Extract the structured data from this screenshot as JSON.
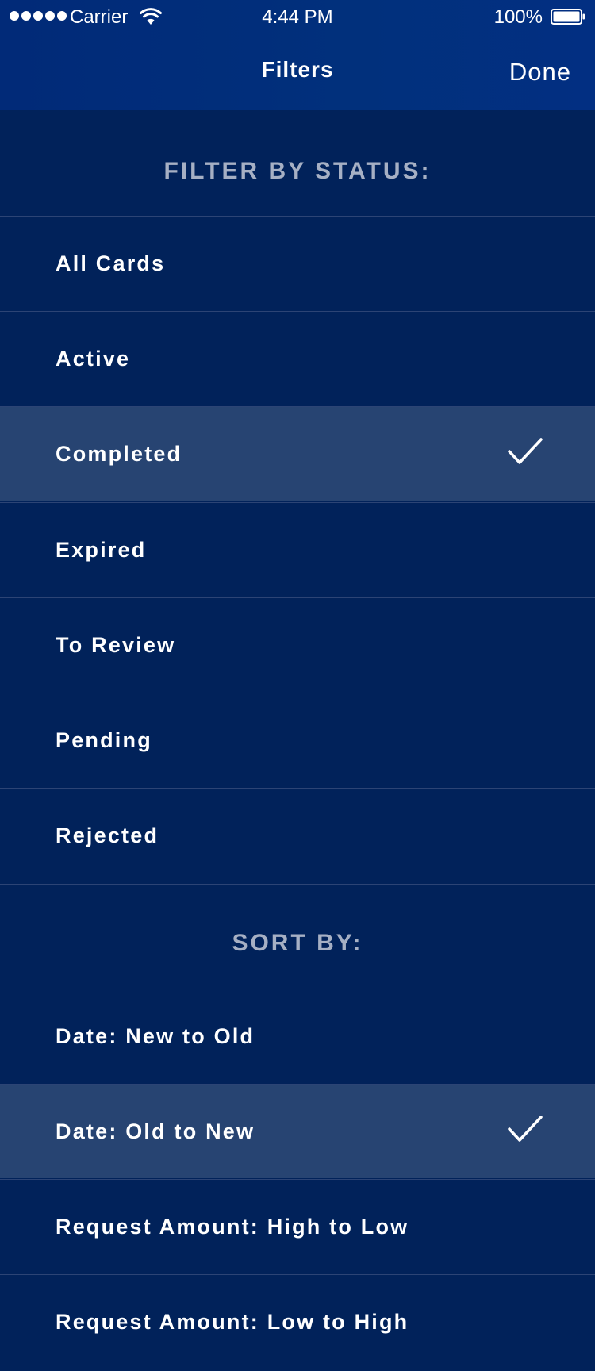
{
  "status_bar": {
    "carrier": "Carrier",
    "time": "4:44 PM",
    "battery": "100%"
  },
  "nav": {
    "title": "Filters",
    "done_label": "Done"
  },
  "filter_section": {
    "header": "FILTER BY STATUS:",
    "items": [
      {
        "label": "All Cards",
        "selected": false
      },
      {
        "label": "Active",
        "selected": false
      },
      {
        "label": "Completed",
        "selected": true
      },
      {
        "label": "Expired",
        "selected": false
      },
      {
        "label": "To Review",
        "selected": false
      },
      {
        "label": "Pending",
        "selected": false
      },
      {
        "label": "Rejected",
        "selected": false
      }
    ]
  },
  "sort_section": {
    "header": "SORT BY:",
    "items": [
      {
        "label": "Date: New to Old",
        "selected": false
      },
      {
        "label": "Date: Old to New",
        "selected": true
      },
      {
        "label": "Request Amount: High to Low",
        "selected": false
      },
      {
        "label": "Request Amount: Low to High",
        "selected": false
      }
    ]
  },
  "colors": {
    "background": "#01225a",
    "topbar": "#012a78",
    "selected_row": "#274472",
    "divider": "#2c4475",
    "section_header": "#a6b0c4",
    "text": "#ffffff"
  },
  "icons": {
    "selected_marker": "checkmark-icon"
  }
}
